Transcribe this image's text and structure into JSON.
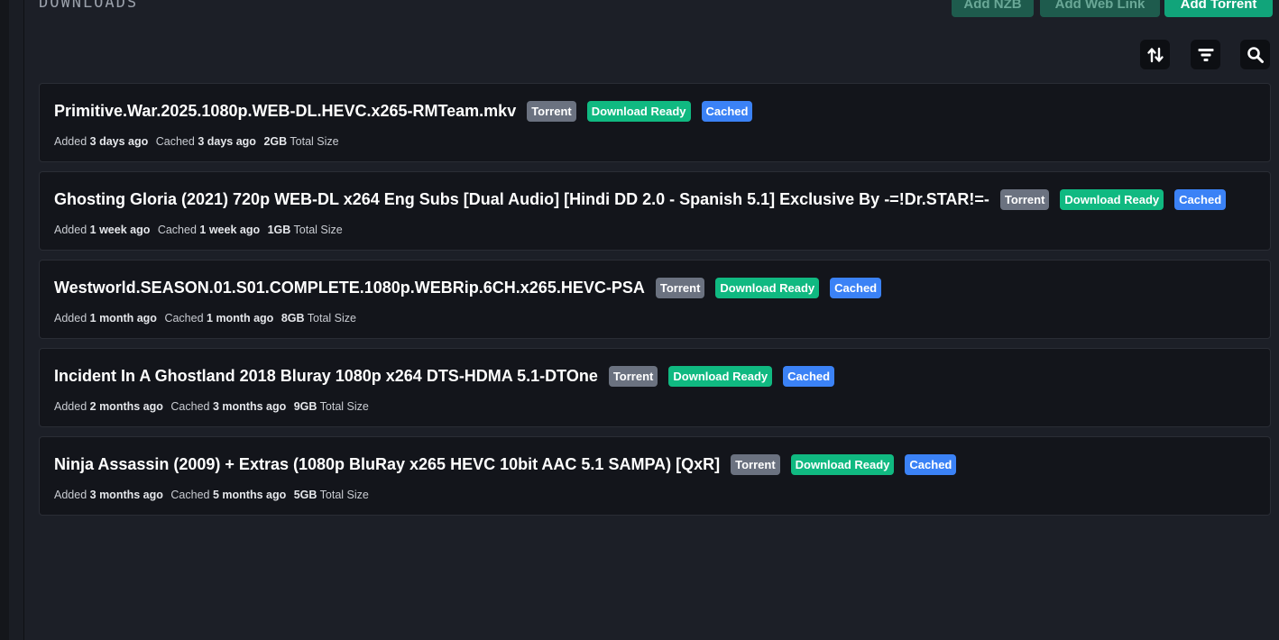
{
  "header": {
    "title": "DOWNLOADS",
    "add_nzb": "Add NZB",
    "add_web_link": "Add Web Link",
    "add_torrent": "Add Torrent"
  },
  "toolbar": {
    "sort_icon": "sort-arrows-icon",
    "filter_icon": "filter-icon",
    "search_icon": "search-icon"
  },
  "labels": {
    "added": "Added",
    "cached": "Cached",
    "total_size": "Total Size"
  },
  "colors": {
    "accent": "#11a47a",
    "badge_torrent": "#6b7280",
    "badge_ready": "#10b981",
    "badge_cached": "#3b82f6"
  },
  "downloads": [
    {
      "name": "Primitive.War.2025.1080p.WEB-DL.HEVC.x265-RMTeam.mkv",
      "type": "Torrent",
      "status": "Download Ready",
      "cache": "Cached",
      "added": "3 days ago",
      "cached": "3 days ago",
      "size": "2GB"
    },
    {
      "name": "Ghosting Gloria (2021) 720p WEB-DL x264 Eng Subs [Dual Audio] [Hindi DD 2.0 - Spanish 5.1] Exclusive By -=!Dr.STAR!=-",
      "type": "Torrent",
      "status": "Download Ready",
      "cache": "Cached",
      "added": "1 week ago",
      "cached": "1 week ago",
      "size": "1GB"
    },
    {
      "name": "Westworld.SEASON.01.S01.COMPLETE.1080p.WEBRip.6CH.x265.HEVC-PSA",
      "type": "Torrent",
      "status": "Download Ready",
      "cache": "Cached",
      "added": "1 month ago",
      "cached": "1 month ago",
      "size": "8GB"
    },
    {
      "name": "Incident In A Ghostland 2018 Bluray 1080p x264 DTS-HDMA 5.1-DTOne",
      "type": "Torrent",
      "status": "Download Ready",
      "cache": "Cached",
      "added": "2 months ago",
      "cached": "3 months ago",
      "size": "9GB"
    },
    {
      "name": "Ninja Assassin (2009) + Extras (1080p BluRay x265 HEVC 10bit AAC 5.1 SAMPA) [QxR]",
      "type": "Torrent",
      "status": "Download Ready",
      "cache": "Cached",
      "added": "3 months ago",
      "cached": "5 months ago",
      "size": "5GB"
    }
  ]
}
